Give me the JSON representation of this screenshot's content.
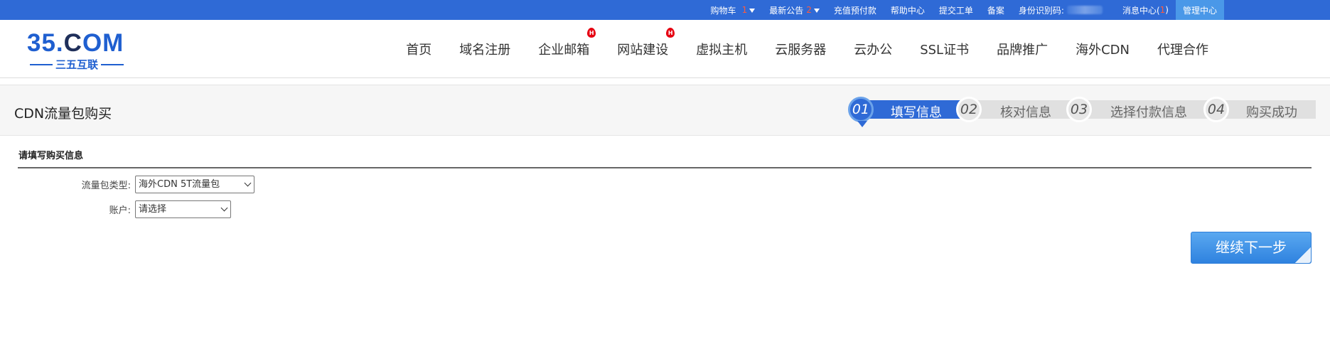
{
  "topbar": {
    "cart_label": "购物车",
    "cart_count": "1",
    "notice_label": "最新公告",
    "notice_count": "2",
    "recharge": "充值预付款",
    "help": "帮助中心",
    "ticket": "提交工单",
    "beian": "备案",
    "id_label": "身份识别码:",
    "message_label": "消息中心(",
    "message_count": "1",
    "message_close": ")",
    "admin": "管理中心"
  },
  "logo": {
    "brand_prefix": "35.",
    "brand_suffix": "OM",
    "tagline": "三五互联"
  },
  "nav": {
    "items": [
      {
        "label": "首页"
      },
      {
        "label": "域名注册"
      },
      {
        "label": "企业邮箱",
        "hot": "H"
      },
      {
        "label": "网站建设",
        "hot": "H"
      },
      {
        "label": "虚拟主机"
      },
      {
        "label": "云服务器"
      },
      {
        "label": "云办公"
      },
      {
        "label": "SSL证书"
      },
      {
        "label": "品牌推广"
      },
      {
        "label": "海外CDN"
      },
      {
        "label": "代理合作"
      }
    ]
  },
  "page": {
    "title": "CDN流量包购买"
  },
  "steps": [
    {
      "num": "01",
      "label": "填写信息",
      "active": true
    },
    {
      "num": "02",
      "label": "核对信息",
      "active": false
    },
    {
      "num": "03",
      "label": "选择付款信息",
      "active": false
    },
    {
      "num": "04",
      "label": "购买成功",
      "active": false
    }
  ],
  "form": {
    "section_title": "请填写购买信息",
    "package_label": "流量包类型:",
    "package_value": "海外CDN 5T流量包",
    "account_label": "账户:",
    "account_value": "请选择"
  },
  "actions": {
    "next_label": "继续下一步"
  },
  "colors": {
    "primary": "#2f6ad6",
    "accent_blue": "#4a98e8",
    "hot_red": "#e60012"
  }
}
